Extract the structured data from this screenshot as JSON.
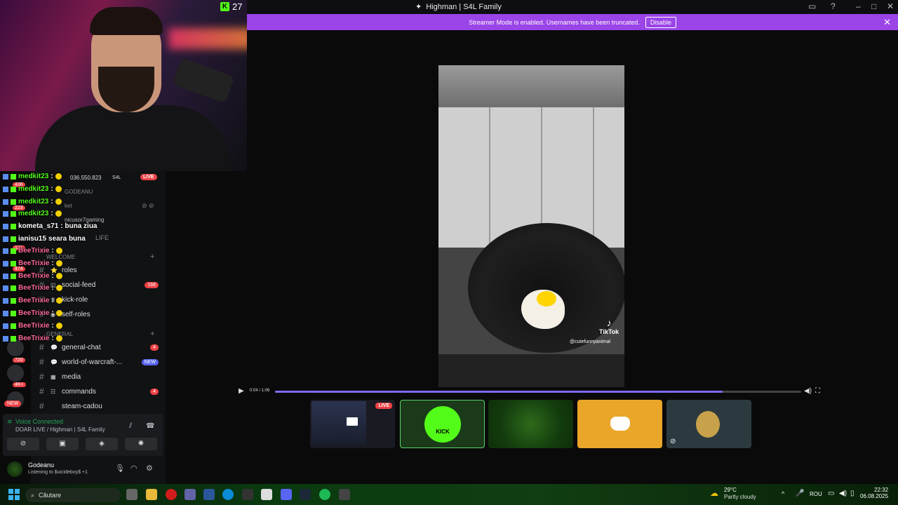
{
  "window": {
    "title": "Highman | S4L Family"
  },
  "banner": {
    "text": "Streamer Mode is enabled. Usernames have been truncated.",
    "disable_label": "Disable"
  },
  "kick_viewers": "27",
  "chat": [
    {
      "user": "medkit23",
      "color": "#53fc18",
      "text": ":"
    },
    {
      "user": "medkit23",
      "color": "#53fc18",
      "text": ":"
    },
    {
      "user": "medkit23",
      "color": "#53fc18",
      "text": ":"
    },
    {
      "user": "medkit23",
      "color": "#53fc18",
      "text": ":"
    },
    {
      "user": "kometa_s71",
      "color": "#ffffff",
      "text": ": buna ziua"
    },
    {
      "user": "ianisu15",
      "color": "#ffffff",
      "text": "seara buna"
    },
    {
      "user": "BeeTrixie",
      "color": "#ff6b9a",
      "text": ":"
    },
    {
      "user": "BeeTrixie",
      "color": "#ff6b9a",
      "text": ":"
    },
    {
      "user": "BeeTrixie",
      "color": "#ff6b9a",
      "text": ":"
    },
    {
      "user": "BeeTrixie",
      "color": "#ff6b9a",
      "text": ":"
    },
    {
      "user": "BeeTrixie",
      "color": "#ff6b9a",
      "text": ":"
    },
    {
      "user": "BeeTrixie",
      "color": "#ff6b9a",
      "text": ":"
    },
    {
      "user": "BeeTrixie",
      "color": "#ff6b9a",
      "text": ":"
    },
    {
      "user": "BeeTrixie",
      "color": "#ff6b9a",
      "text": ":"
    }
  ],
  "sidebar": {
    "stream_info": "036.550.823",
    "stream_tag": "S4L",
    "live_label": "LIVE",
    "godeanu": "GODEANU",
    "ket": "ket",
    "nicusor": "nicusor7gaming",
    "life": "LIFE",
    "welcome_cat": "WELCOME",
    "general_cat": "GENERAL",
    "channels": [
      {
        "name": "roles",
        "badge": "",
        "new": ""
      },
      {
        "name": "social-feed",
        "badge": "166",
        "new": ""
      },
      {
        "name": "kick-role",
        "badge": "",
        "new": ""
      },
      {
        "name": "self-roles",
        "badge": "",
        "new": ""
      },
      {
        "name": "general-chat",
        "badge": "4",
        "new": ""
      },
      {
        "name": "world-of-warcraft-...",
        "badge": "",
        "new": "NEW"
      },
      {
        "name": "media",
        "badge": "",
        "new": ""
      },
      {
        "name": "commands",
        "badge": "4",
        "new": ""
      },
      {
        "name": "steam-cadou",
        "badge": "",
        "new": ""
      }
    ],
    "server_badges": [
      "436",
      "223",
      "121",
      "474",
      "720",
      "4K+"
    ],
    "new_label": "NEW"
  },
  "voice": {
    "status": "Voice Connected",
    "server": "DOAR LIVE / Highman | S4L Family"
  },
  "user": {
    "name": "Godeanu",
    "status": "Listening to $uicideboy$ +1"
  },
  "player": {
    "time": "0:04 / 1:06",
    "progress": 0.85
  },
  "video": {
    "tiktok": "TikTok",
    "tiktok_user": "@cutefunnyanimal"
  },
  "tiles": {
    "live_label": "LIVE",
    "kick_label": "KICK"
  },
  "taskbar": {
    "search": "Căutare",
    "temp": "29°C",
    "weather": "Partly cloudy",
    "lang": "ROU",
    "time": "22:32",
    "date": "06.08.2025"
  }
}
